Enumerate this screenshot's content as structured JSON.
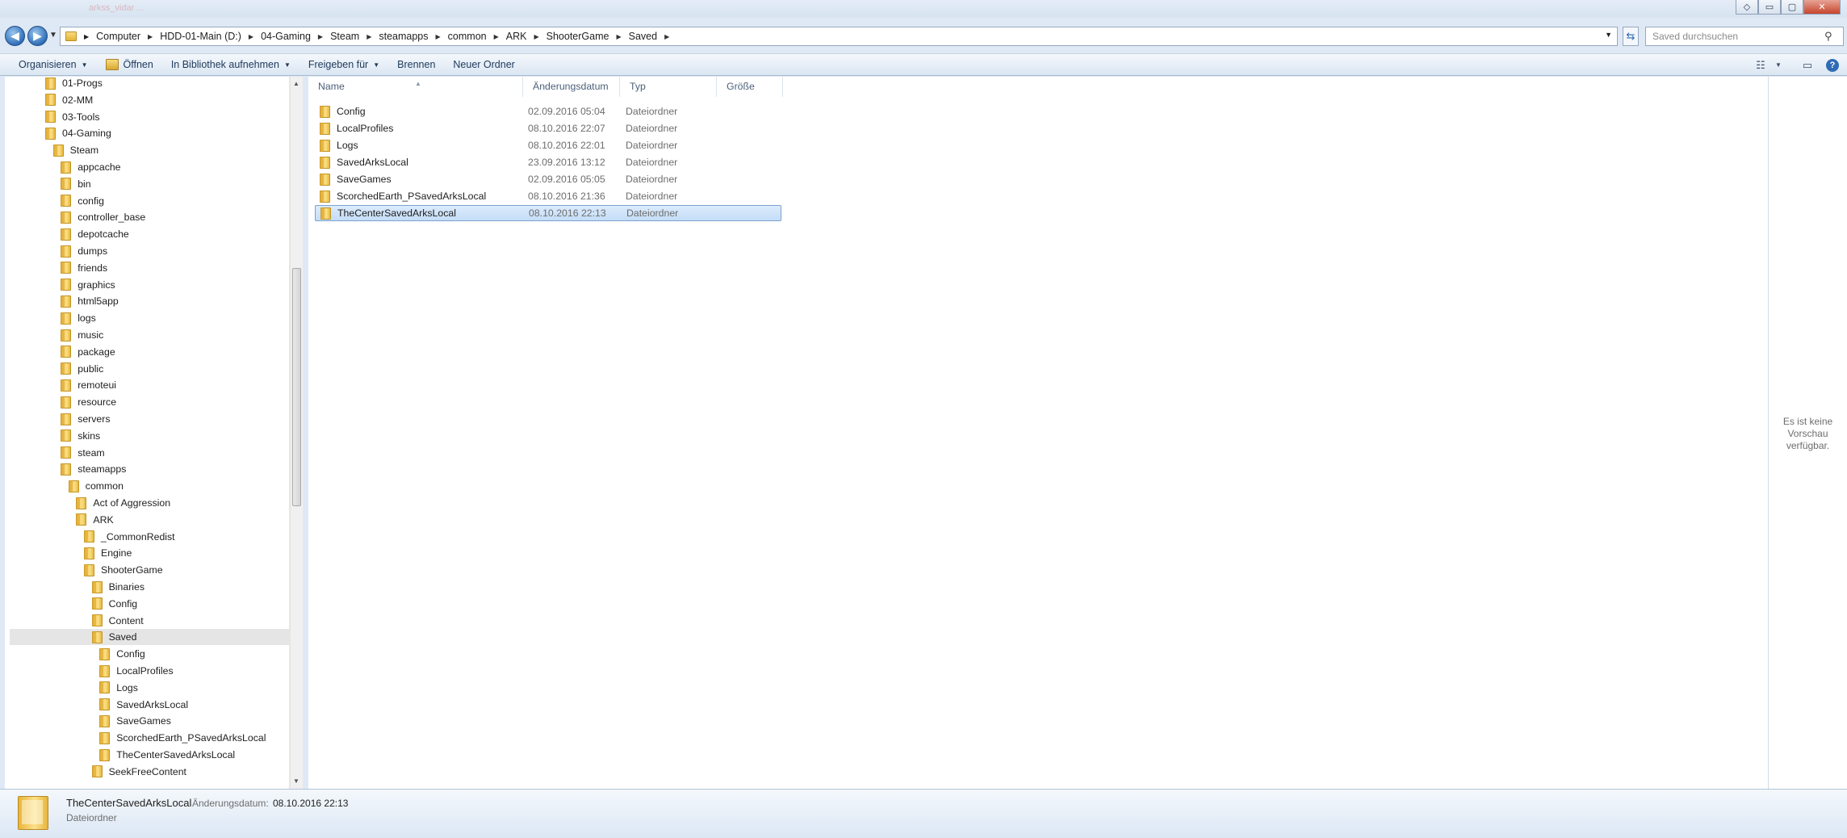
{
  "window": {
    "ghost_title": "arkss_vidar ...",
    "buttons": {
      "minimize": "▭",
      "maximize": "▢",
      "close": "✕",
      "extra": "◇"
    }
  },
  "address": {
    "crumbs": [
      "Computer",
      "HDD-01-Main (D:)",
      "04-Gaming",
      "Steam",
      "steamapps",
      "common",
      "ARK",
      "ShooterGame",
      "Saved"
    ],
    "search_placeholder": "Saved durchsuchen"
  },
  "commands": {
    "organize": "Organisieren",
    "open": "Öffnen",
    "library": "In Bibliothek aufnehmen",
    "share": "Freigeben für",
    "burn": "Brennen",
    "new_folder": "Neuer Ordner"
  },
  "tree": [
    {
      "label": "01-Progs",
      "level": 0
    },
    {
      "label": "02-MM",
      "level": 0
    },
    {
      "label": "03-Tools",
      "level": 0
    },
    {
      "label": "04-Gaming",
      "level": 0
    },
    {
      "label": "Steam",
      "level": 1
    },
    {
      "label": "appcache",
      "level": 2
    },
    {
      "label": "bin",
      "level": 2
    },
    {
      "label": "config",
      "level": 2
    },
    {
      "label": "controller_base",
      "level": 2
    },
    {
      "label": "depotcache",
      "level": 2
    },
    {
      "label": "dumps",
      "level": 2
    },
    {
      "label": "friends",
      "level": 2
    },
    {
      "label": "graphics",
      "level": 2
    },
    {
      "label": "html5app",
      "level": 2
    },
    {
      "label": "logs",
      "level": 2
    },
    {
      "label": "music",
      "level": 2
    },
    {
      "label": "package",
      "level": 2
    },
    {
      "label": "public",
      "level": 2
    },
    {
      "label": "remoteui",
      "level": 2
    },
    {
      "label": "resource",
      "level": 2
    },
    {
      "label": "servers",
      "level": 2
    },
    {
      "label": "skins",
      "level": 2
    },
    {
      "label": "steam",
      "level": 2
    },
    {
      "label": "steamapps",
      "level": 2
    },
    {
      "label": "common",
      "level": 3
    },
    {
      "label": "Act of Aggression",
      "level": 4
    },
    {
      "label": "ARK",
      "level": 4
    },
    {
      "label": "_CommonRedist",
      "level": 5
    },
    {
      "label": "Engine",
      "level": 5
    },
    {
      "label": "ShooterGame",
      "level": 5
    },
    {
      "label": "Binaries",
      "level": 6
    },
    {
      "label": "Config",
      "level": 6
    },
    {
      "label": "Content",
      "level": 6
    },
    {
      "label": "Saved",
      "level": 6,
      "selected": true
    },
    {
      "label": "Config",
      "level": 7
    },
    {
      "label": "LocalProfiles",
      "level": 7
    },
    {
      "label": "Logs",
      "level": 7
    },
    {
      "label": "SavedArksLocal",
      "level": 7
    },
    {
      "label": "SaveGames",
      "level": 7
    },
    {
      "label": "ScorchedEarth_PSavedArksLocal",
      "level": 7
    },
    {
      "label": "TheCenterSavedArksLocal",
      "level": 7
    },
    {
      "label": "SeekFreeContent",
      "level": 6
    }
  ],
  "columns": {
    "name": "Name",
    "date": "Änderungsdatum",
    "type": "Typ",
    "size": "Größe"
  },
  "files": [
    {
      "name": "Config",
      "date": "02.09.2016 05:04",
      "type": "Dateiordner",
      "size": ""
    },
    {
      "name": "LocalProfiles",
      "date": "08.10.2016 22:07",
      "type": "Dateiordner",
      "size": ""
    },
    {
      "name": "Logs",
      "date": "08.10.2016 22:01",
      "type": "Dateiordner",
      "size": ""
    },
    {
      "name": "SavedArksLocal",
      "date": "23.09.2016 13:12",
      "type": "Dateiordner",
      "size": ""
    },
    {
      "name": "SaveGames",
      "date": "02.09.2016 05:05",
      "type": "Dateiordner",
      "size": ""
    },
    {
      "name": "ScorchedEarth_PSavedArksLocal",
      "date": "08.10.2016 21:36",
      "type": "Dateiordner",
      "size": ""
    },
    {
      "name": "TheCenterSavedArksLocal",
      "date": "08.10.2016 22:13",
      "type": "Dateiordner",
      "size": "",
      "selected": true
    }
  ],
  "preview": {
    "text": "Es ist keine Vorschau verfügbar."
  },
  "details": {
    "name": "TheCenterSavedArksLocal",
    "date_label": "Änderungsdatum:",
    "date": "08.10.2016 22:13",
    "type": "Dateiordner"
  }
}
